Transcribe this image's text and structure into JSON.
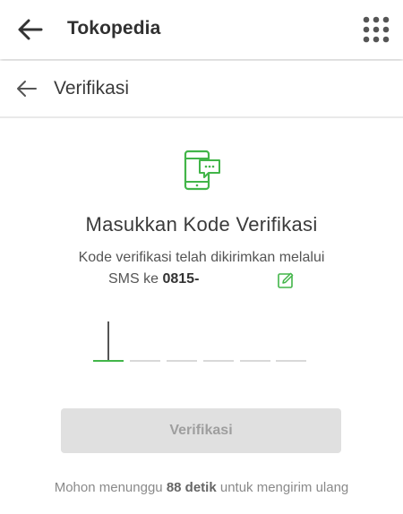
{
  "appbar": {
    "title": "Tokopedia",
    "back_icon": "arrow-left-icon",
    "menu_icon": "apps-grid-icon"
  },
  "subbar": {
    "title": "Verifikasi",
    "back_icon": "arrow-left-icon"
  },
  "main": {
    "hero_icon": "phone-message-icon",
    "heading": "Masukkan Kode Verifikasi",
    "description": "Kode verifikasi telah dikirimkan melalui",
    "sms_prefix": "SMS ke",
    "phone": "0815-",
    "edit_icon": "edit-icon",
    "otp_length": 6,
    "verify_label": "Verifikasi",
    "resend": {
      "prefix": "Mohon menunggu",
      "seconds": "88 detik",
      "suffix": "untuk mengirim ulang"
    }
  },
  "colors": {
    "accent": "#42b549",
    "button_disabled_bg": "#e0e0e0",
    "button_disabled_text": "#9e9e9e"
  }
}
